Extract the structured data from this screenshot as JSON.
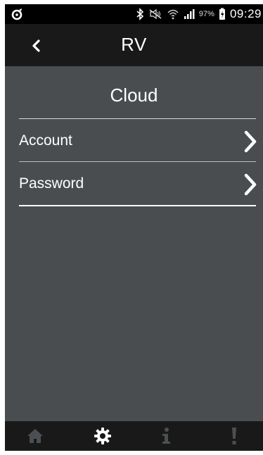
{
  "status_bar": {
    "battery_percent": "97%",
    "time": "09:29",
    "icons": [
      "app-notification-icon",
      "bluetooth-icon",
      "mute-icon",
      "wifi-icon",
      "signal-icon",
      "battery-charging-icon"
    ]
  },
  "header": {
    "title": "RV",
    "back_icon": "back-chevron-icon"
  },
  "section": {
    "title": "Cloud"
  },
  "menu": {
    "items": [
      {
        "label": "Account"
      },
      {
        "label": "Password"
      }
    ]
  },
  "tab_bar": {
    "tabs": [
      {
        "icon": "home-icon",
        "active": false
      },
      {
        "icon": "gear-icon",
        "active": true
      },
      {
        "icon": "info-icon",
        "active": false
      },
      {
        "icon": "alert-icon",
        "active": false
      }
    ]
  },
  "colors": {
    "background": "#4a4d4f",
    "header": "#191919",
    "text": "#ffffff",
    "active_icon": "#ffffff",
    "inactive_icon": "#4b4f52"
  }
}
